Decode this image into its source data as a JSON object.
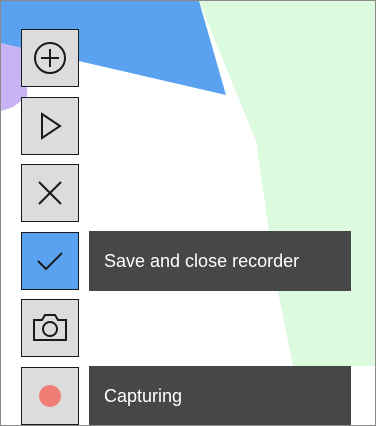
{
  "toolbar": {
    "buttons": [
      {
        "id": "add",
        "icon": "plus-circle-icon",
        "active": false
      },
      {
        "id": "play",
        "icon": "play-icon",
        "active": false
      },
      {
        "id": "stop",
        "icon": "close-icon",
        "active": false
      },
      {
        "id": "save",
        "icon": "checkmark-icon",
        "active": true
      },
      {
        "id": "screenshot",
        "icon": "camera-icon",
        "active": false
      },
      {
        "id": "record",
        "icon": "record-dot-icon",
        "active": false
      }
    ]
  },
  "tooltips": {
    "save": "Save and close recorder",
    "record": "Capturing"
  },
  "colors": {
    "active_button": "#5aa2f0",
    "button": "#dcdcdc",
    "tooltip_bg": "#474747",
    "record_dot": "#ef7f76",
    "bg_blue": "#5aa2f0",
    "bg_green": "#dcfade",
    "bg_lavender": "#c8b4f5"
  }
}
